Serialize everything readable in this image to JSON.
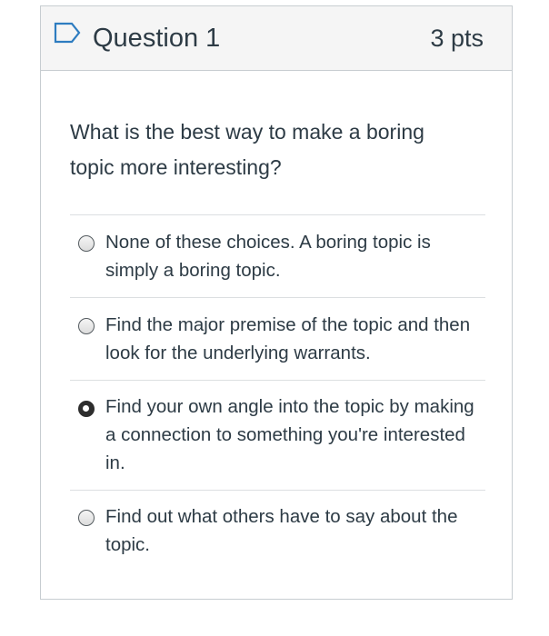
{
  "question": {
    "title": "Question 1",
    "points": "3 pts",
    "text": "What is the best way to make a boring topic more interesting?"
  },
  "answers": [
    {
      "label": "None of these choices. A boring topic is simply a boring topic.",
      "selected": false
    },
    {
      "label": "Find the major premise of the topic and then look for the underlying warrants.",
      "selected": false
    },
    {
      "label": "Find your own angle into the topic by making a connection to something you're interested in.",
      "selected": true
    },
    {
      "label": "Find out what others have to say about the topic.",
      "selected": false
    }
  ],
  "icons": {
    "flag": "flag-outline-icon"
  },
  "colors": {
    "text": "#2d3b45",
    "header_bg": "#f5f5f5",
    "border": "#c7cdd1",
    "flag_blue": "#2d7cc0"
  }
}
